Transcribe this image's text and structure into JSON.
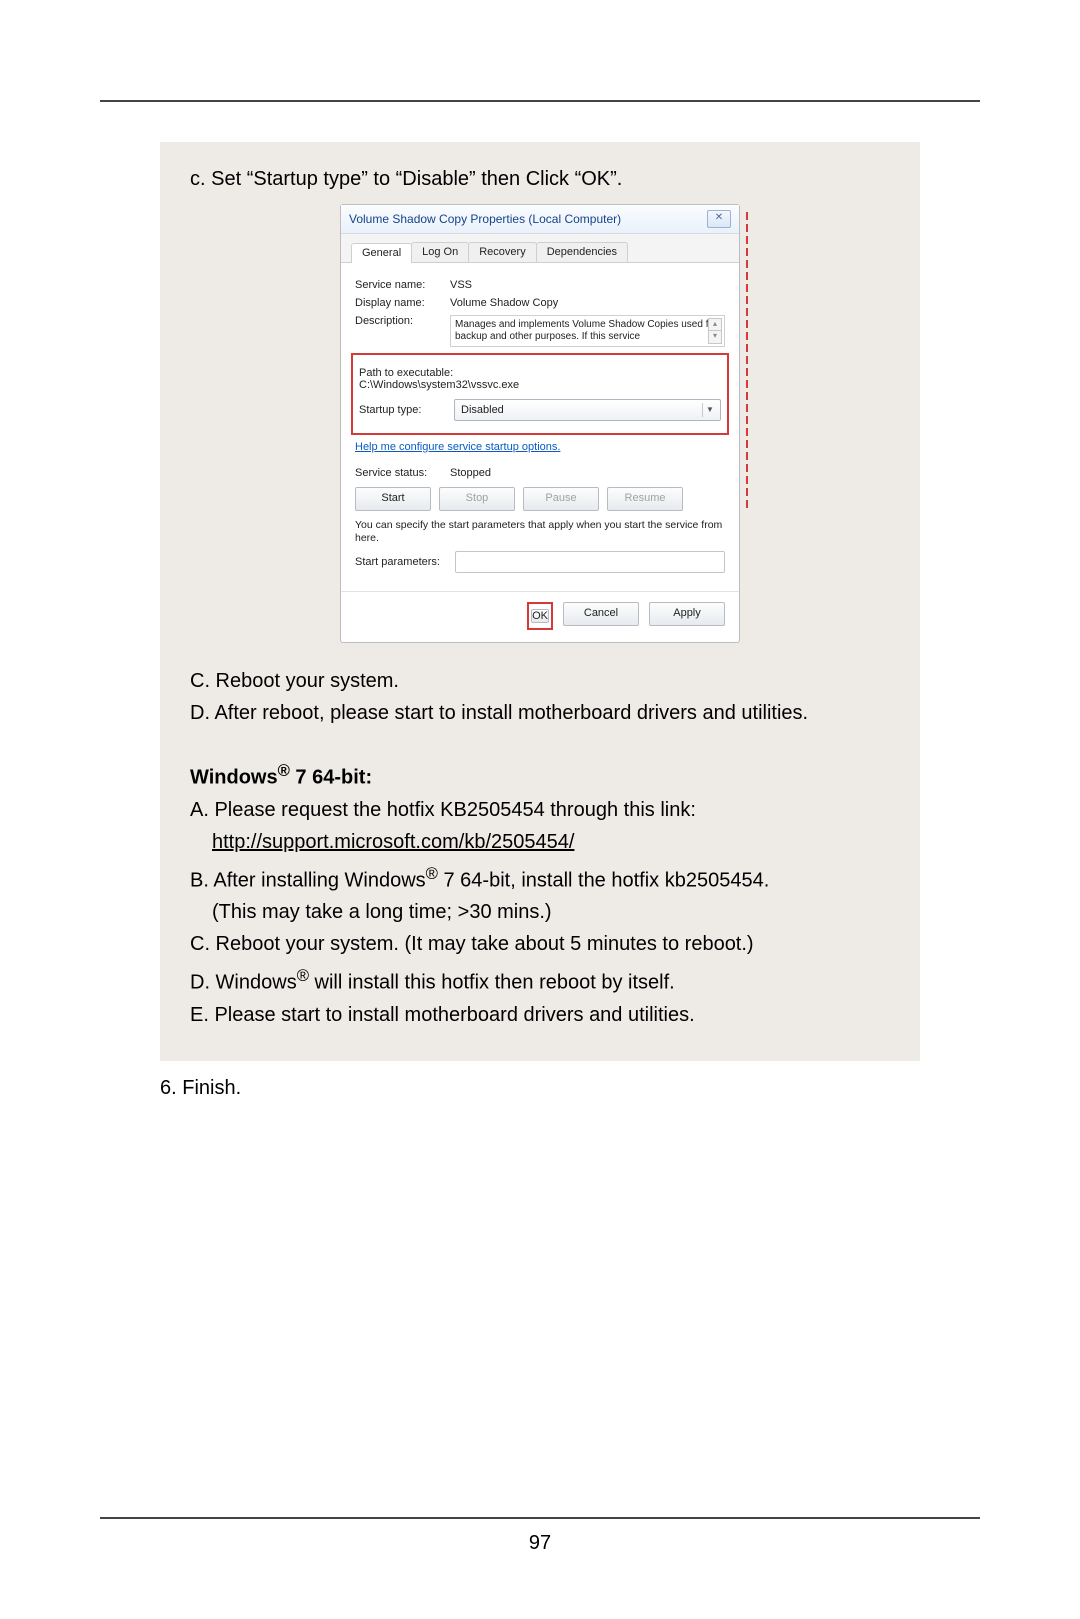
{
  "step_c": "c. Set “Startup type” to “Disable” then Click “OK”.",
  "dialog": {
    "title": "Volume Shadow Copy Properties (Local Computer)",
    "tabs": {
      "general": "General",
      "logon": "Log On",
      "recovery": "Recovery",
      "deps": "Dependencies"
    },
    "service_name_lab": "Service name:",
    "service_name": "VSS",
    "display_name_lab": "Display name:",
    "display_name": "Volume Shadow Copy",
    "description_lab": "Description:",
    "description": "Manages and implements Volume Shadow Copies used for backup and other purposes. If this service",
    "path_lab": "Path to executable:",
    "path": "C:\\Windows\\system32\\vssvc.exe",
    "startup_lab": "Startup type:",
    "startup_val": "Disabled",
    "help": "Help me configure service startup options.",
    "status_lab": "Service status:",
    "status_val": "Stopped",
    "btn_start": "Start",
    "btn_stop": "Stop",
    "btn_pause": "Pause",
    "btn_resume": "Resume",
    "hint": "You can specify the start parameters that apply when you start the service from here.",
    "startparams_lab": "Start parameters:",
    "ok": "OK",
    "cancel": "Cancel",
    "apply": "Apply"
  },
  "after": {
    "c": "C. Reboot your system.",
    "d": "D. After reboot, please start to install motherboard drivers and utilities.",
    "win_heading_a": "Windows",
    "win_heading_b": " 7 64-bit:",
    "a": "A. Please request the hotfix KB2505454 through this link:",
    "a_link": "http://support.microsoft.com/kb/2505454/",
    "b1": "B. After installing Windows",
    "b2": " 7 64-bit, install the hotfix kb2505454.",
    "b3": "(This may take a long time; >30 mins.)",
    "c2": "C. Reboot your system. (It may take about 5 minutes to reboot.)",
    "d2a": "D. Windows",
    "d2b": " will install this hotfix then reboot by itself.",
    "e": "E. Please start to install motherboard drivers and utilities."
  },
  "finish": "6. Finish.",
  "pagenum": "97"
}
